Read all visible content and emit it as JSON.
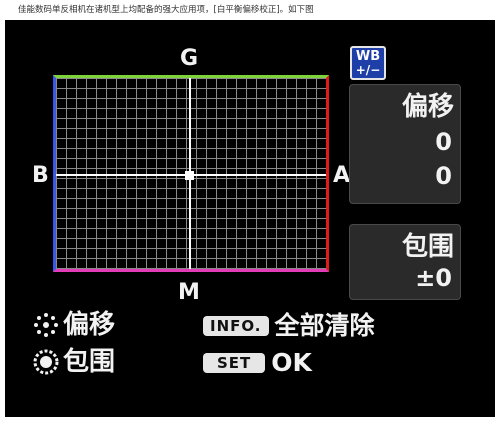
{
  "caption": "佳能数码单反相机在诸机型上均配备的强大应用项，[白平衡偏移校正]。如下图",
  "axes": {
    "top": "G",
    "bottom": "M",
    "left": "B",
    "right": "A"
  },
  "wb_badge": {
    "line1": "WB",
    "line2": "+/−"
  },
  "shift_panel": {
    "title": "偏移",
    "value1": "0",
    "value2": "0"
  },
  "bracket_panel": {
    "title": "包围",
    "value": "±0"
  },
  "legend": {
    "shift_label": "偏移",
    "bracket_label": "包围"
  },
  "controls": {
    "info_key": "INFO.",
    "info_action": "全部清除",
    "set_key": "SET",
    "set_action": "OK"
  },
  "grid": {
    "shift_x": 0,
    "shift_y": 0
  },
  "colors": {
    "top_edge": "#7ed23a",
    "bottom_edge": "#e43bb8",
    "left_edge": "#3a56e6",
    "right_edge": "#e01a1a",
    "badge": "#1f3fa8"
  }
}
